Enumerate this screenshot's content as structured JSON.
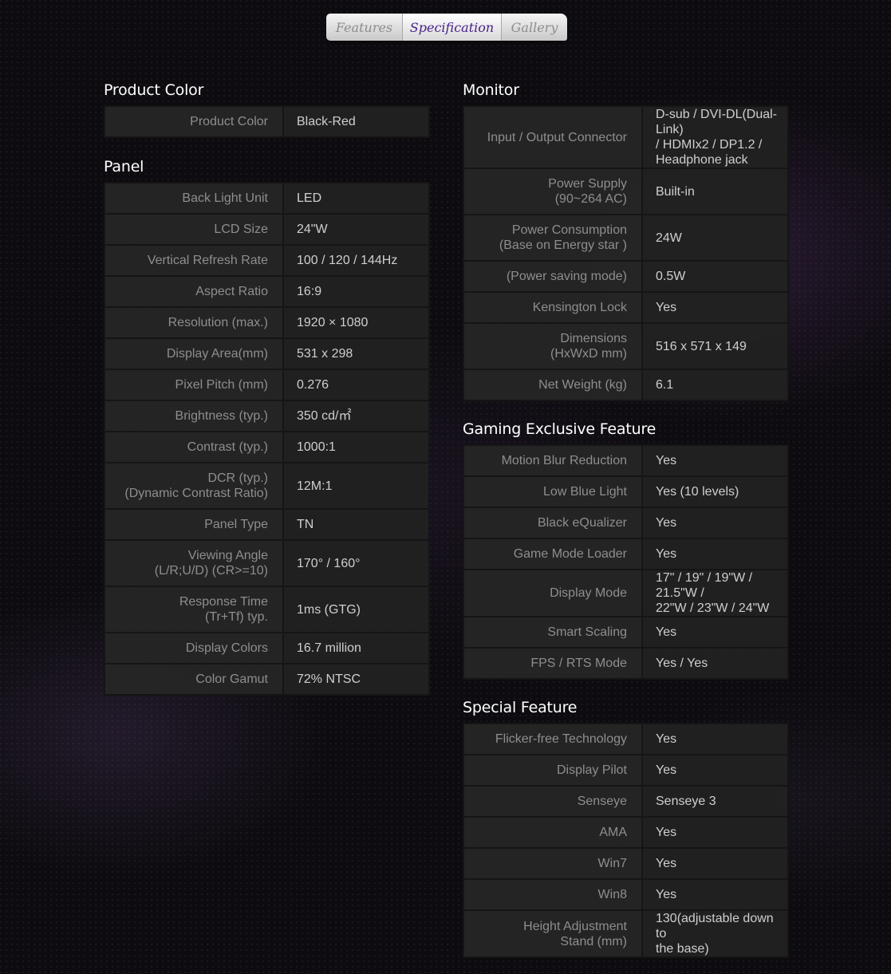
{
  "tabs": [
    {
      "label": "Features"
    },
    {
      "label": "Specification"
    },
    {
      "label": "Gallery"
    }
  ],
  "active_tab": "Specification",
  "sections": {
    "product_color": {
      "title": "Product Color",
      "rows": [
        {
          "label": "Product Color",
          "value": "Black-Red"
        }
      ]
    },
    "panel": {
      "title": "Panel",
      "rows": [
        {
          "label": "Back Light Unit",
          "value": "LED"
        },
        {
          "label": "LCD Size",
          "value": "24\"W"
        },
        {
          "label": "Vertical Refresh Rate",
          "value": "100 / 120 / 144Hz"
        },
        {
          "label": "Aspect Ratio",
          "value": "16:9"
        },
        {
          "label": "Resolution (max.)",
          "value": "1920 × 1080"
        },
        {
          "label": "Display Area(mm)",
          "value": "531 x 298"
        },
        {
          "label": "Pixel Pitch (mm)",
          "value": "0.276"
        },
        {
          "label": "Brightness (typ.)",
          "value": "350 cd/㎡"
        },
        {
          "label": "Contrast (typ.)",
          "value": "1000:1"
        },
        {
          "label": "DCR (typ.)",
          "label2": "(Dynamic Contrast Ratio)",
          "value": "12M:1"
        },
        {
          "label": "Panel Type",
          "value": "TN"
        },
        {
          "label": "Viewing Angle",
          "label2": "(L/R;U/D) (CR>=10)",
          "value": "170° / 160°"
        },
        {
          "label": "Response Time",
          "label2": "(Tr+Tf) typ.",
          "value": "1ms (GTG)"
        },
        {
          "label": "Display Colors",
          "value": "16.7 million"
        },
        {
          "label": "Color Gamut",
          "value": "72% NTSC"
        }
      ]
    },
    "monitor": {
      "title": "Monitor",
      "rows": [
        {
          "label": "Input / Output Connector",
          "value": "D-sub / DVI-DL(Dual-Link)",
          "value2": "/ HDMIx2 / DP1.2 /",
          "value3": "Headphone jack"
        },
        {
          "label": "Power Supply",
          "label2": "(90~264 AC)",
          "value": "Built-in"
        },
        {
          "label": "Power Consumption",
          "label2": "(Base on Energy star )",
          "value": "24W"
        },
        {
          "label": "(Power saving mode)",
          "value": "0.5W"
        },
        {
          "label": "Kensington Lock",
          "value": "Yes"
        },
        {
          "label": "Dimensions",
          "label2": "(HxWxD mm)",
          "value": "516 x 571 x 149"
        },
        {
          "label": "Net Weight (kg)",
          "value": "6.1"
        }
      ]
    },
    "gaming": {
      "title": "Gaming Exclusive Feature",
      "rows": [
        {
          "label": "Motion Blur Reduction",
          "value": "Yes"
        },
        {
          "label": "Low Blue Light",
          "value": "Yes (10 levels)"
        },
        {
          "label": "Black eQualizer",
          "value": "Yes"
        },
        {
          "label": "Game Mode Loader",
          "value": "Yes"
        },
        {
          "label": "Display Mode",
          "value": "17\" / 19\" / 19\"W / 21.5\"W /",
          "value2": "22\"W / 23\"W / 24\"W"
        },
        {
          "label": "Smart Scaling",
          "value": "Yes"
        },
        {
          "label": "FPS / RTS Mode",
          "value": "Yes / Yes"
        }
      ]
    },
    "special": {
      "title": "Special Feature",
      "rows": [
        {
          "label": "Flicker-free Technology",
          "value": "Yes"
        },
        {
          "label": "Display Pilot",
          "value": "Yes"
        },
        {
          "label": "Senseye",
          "value": "Senseye 3"
        },
        {
          "label": "AMA",
          "value": "Yes"
        },
        {
          "label": "Win7",
          "value": "Yes"
        },
        {
          "label": "Win8",
          "value": "Yes"
        },
        {
          "label": "Height Adjustment",
          "label2": "Stand (mm)",
          "value": "130(adjustable down to",
          "value2": "the base)"
        }
      ]
    }
  }
}
